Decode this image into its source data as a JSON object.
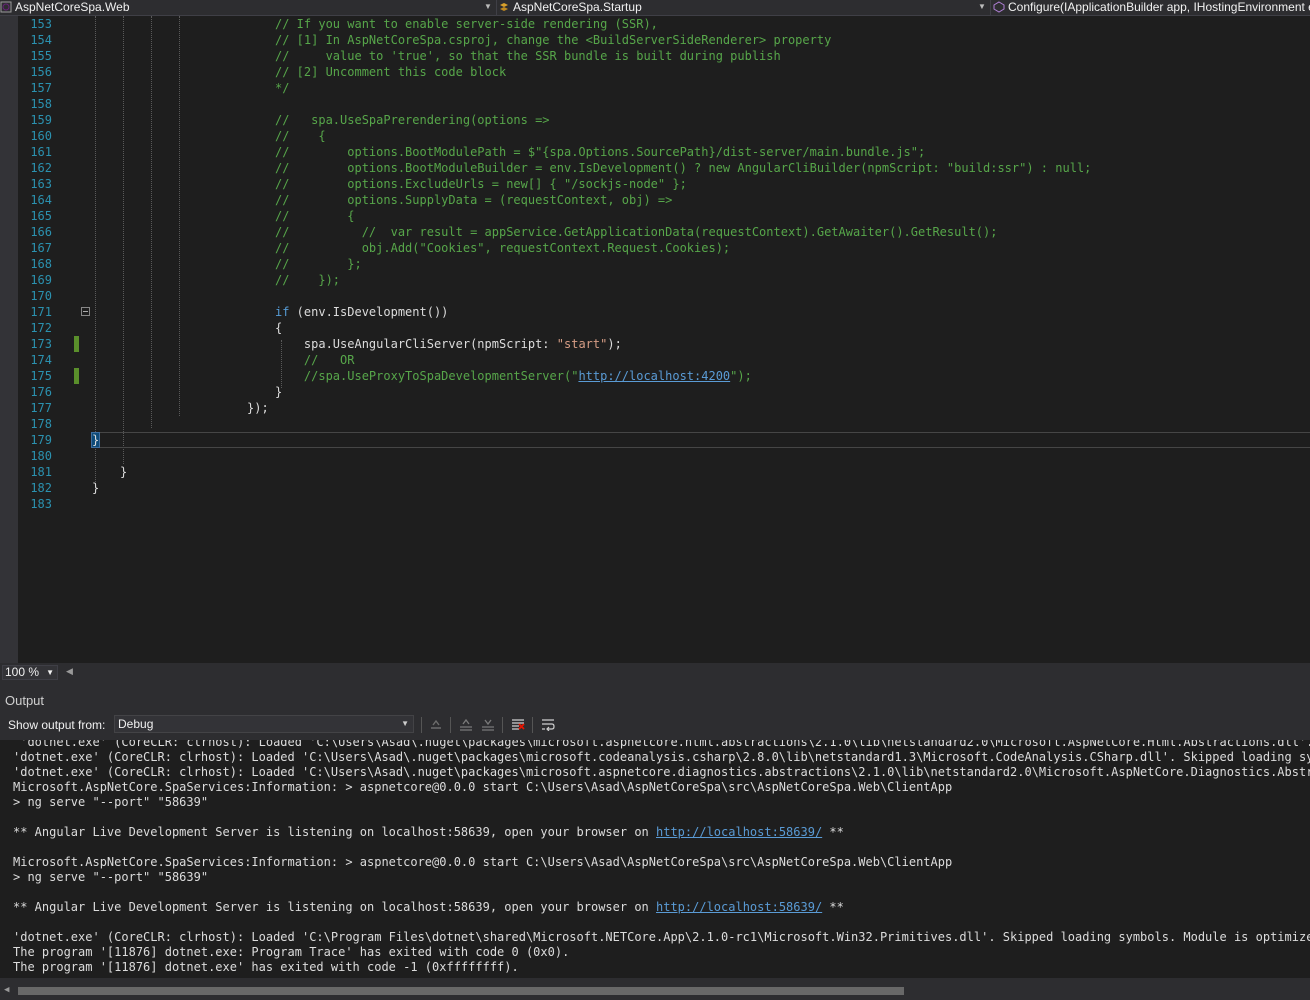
{
  "navbar": {
    "project": "AspNetCoreSpa.Web",
    "class": "AspNetCoreSpa.Startup",
    "member": "Configure(IApplicationBuilder app, IHostingEnvironment env)"
  },
  "editor": {
    "zoom": "100 %",
    "lines": [
      {
        "n": "153",
        "parts": [
          {
            "t": "cm",
            "v": "// If you want to enable server-side rendering (SSR),"
          }
        ]
      },
      {
        "n": "154",
        "parts": [
          {
            "t": "cm",
            "v": "// [1] In AspNetCoreSpa.csproj, change the <BuildServerSideRenderer> property"
          }
        ]
      },
      {
        "n": "155",
        "parts": [
          {
            "t": "cm",
            "v": "//     value to 'true', so that the SSR bundle is built during publish"
          }
        ]
      },
      {
        "n": "156",
        "parts": [
          {
            "t": "cm",
            "v": "// [2] Uncomment this code block"
          }
        ]
      },
      {
        "n": "157",
        "parts": [
          {
            "t": "cm",
            "v": "*/"
          }
        ]
      },
      {
        "n": "158",
        "parts": []
      },
      {
        "n": "159",
        "parts": [
          {
            "t": "cm",
            "v": "//   spa.UseSpaPrerendering(options =>"
          }
        ]
      },
      {
        "n": "160",
        "parts": [
          {
            "t": "cm",
            "v": "//    {"
          }
        ]
      },
      {
        "n": "161",
        "parts": [
          {
            "t": "cm",
            "v": "//        options.BootModulePath = $\"{spa.Options.SourcePath}/dist-server/main.bundle.js\";"
          }
        ]
      },
      {
        "n": "162",
        "parts": [
          {
            "t": "cm",
            "v": "//        options.BootModuleBuilder = env.IsDevelopment() ? new AngularCliBuilder(npmScript: \"build:ssr\") : null;"
          }
        ]
      },
      {
        "n": "163",
        "parts": [
          {
            "t": "cm",
            "v": "//        options.ExcludeUrls = new[] { \"/sockjs-node\" };"
          }
        ]
      },
      {
        "n": "164",
        "parts": [
          {
            "t": "cm",
            "v": "//        options.SupplyData = (requestContext, obj) =>"
          }
        ]
      },
      {
        "n": "165",
        "parts": [
          {
            "t": "cm",
            "v": "//        {"
          }
        ]
      },
      {
        "n": "166",
        "parts": [
          {
            "t": "cm",
            "v": "//          //  var result = appService.GetApplicationData(requestContext).GetAwaiter().GetResult();"
          }
        ]
      },
      {
        "n": "167",
        "parts": [
          {
            "t": "cm",
            "v": "//          obj.Add(\"Cookies\", requestContext.Request.Cookies);"
          }
        ]
      },
      {
        "n": "168",
        "parts": [
          {
            "t": "cm",
            "v": "//        };"
          }
        ]
      },
      {
        "n": "169",
        "parts": [
          {
            "t": "cm",
            "v": "//    });"
          }
        ]
      },
      {
        "n": "170",
        "parts": []
      },
      {
        "n": "171",
        "parts": [
          {
            "t": "kw",
            "v": "if"
          },
          {
            "t": "pl",
            "v": " (env.IsDevelopment())"
          }
        ]
      },
      {
        "n": "172",
        "parts": [
          {
            "t": "pl",
            "v": "{"
          }
        ]
      },
      {
        "n": "173",
        "parts": [
          {
            "t": "pl",
            "v": "    spa.UseAngularCliServer(npmScript: "
          },
          {
            "t": "str",
            "v": "\"start\""
          },
          {
            "t": "pl",
            "v": ");"
          }
        ]
      },
      {
        "n": "174",
        "parts": [
          {
            "t": "cm",
            "v": "    //   OR"
          }
        ]
      },
      {
        "n": "175",
        "parts": [
          {
            "t": "cm",
            "v": "    //spa.UseProxyToSpaDevelopmentServer(\""
          },
          {
            "t": "url",
            "v": "http://localhost:4200"
          },
          {
            "t": "cm",
            "v": "\");"
          }
        ]
      },
      {
        "n": "176",
        "parts": [
          {
            "t": "pl",
            "v": "}"
          }
        ]
      },
      {
        "n": "177",
        "parts": [
          {
            "t": "pl",
            "v": "});"
          }
        ]
      },
      {
        "n": "178",
        "parts": []
      },
      {
        "n": "179",
        "parts": [
          {
            "t": "br",
            "v": "}"
          }
        ]
      },
      {
        "n": "180",
        "parts": []
      },
      {
        "n": "181",
        "parts": [
          {
            "t": "pl",
            "v": "}"
          }
        ]
      },
      {
        "n": "182",
        "parts": [
          {
            "t": "pl",
            "v": "}"
          }
        ]
      },
      {
        "n": "183",
        "parts": []
      }
    ]
  },
  "output": {
    "title": "Output",
    "show_from_label": "Show output from:",
    "source": "Debug",
    "lines": [
      {
        "parts": [
          {
            "t": "pl",
            "v": " 'dotnet.exe' (CoreCLR: clrhost): Loaded 'C:\\Users\\Asad\\.nuget\\packages\\microsoft.aspnetcore.html.abstractions\\2.1.0\\lib\\netstandard2.0\\Microsoft.AspNetCore.Html.Abstractions.dll'. Skipped loading symbols."
          }
        ]
      },
      {
        "parts": [
          {
            "t": "pl",
            "v": "'dotnet.exe' (CoreCLR: clrhost): Loaded 'C:\\Users\\Asad\\.nuget\\packages\\microsoft.codeanalysis.csharp\\2.8.0\\lib\\netstandard1.3\\Microsoft.CodeAnalysis.CSharp.dll'. Skipped loading symbols. Module is optimized"
          }
        ]
      },
      {
        "parts": [
          {
            "t": "pl",
            "v": "'dotnet.exe' (CoreCLR: clrhost): Loaded 'C:\\Users\\Asad\\.nuget\\packages\\microsoft.aspnetcore.diagnostics.abstractions\\2.1.0\\lib\\netstandard2.0\\Microsoft.AspNetCore.Diagnostics.Abstractions.dll'."
          }
        ]
      },
      {
        "parts": [
          {
            "t": "pl",
            "v": "Microsoft.AspNetCore.SpaServices:Information: > aspnetcore@0.0.0 start C:\\Users\\Asad\\AspNetCoreSpa\\src\\AspNetCoreSpa.Web\\ClientApp"
          }
        ]
      },
      {
        "parts": [
          {
            "t": "pl",
            "v": "> ng serve \"--port\" \"58639\""
          }
        ]
      },
      {
        "parts": []
      },
      {
        "parts": [
          {
            "t": "pl",
            "v": "** Angular Live Development Server is listening on localhost:58639, open your browser on "
          },
          {
            "t": "url",
            "v": "http://localhost:58639/"
          },
          {
            "t": "pl",
            "v": " **"
          }
        ]
      },
      {
        "parts": []
      },
      {
        "parts": [
          {
            "t": "pl",
            "v": "Microsoft.AspNetCore.SpaServices:Information: > aspnetcore@0.0.0 start C:\\Users\\Asad\\AspNetCoreSpa\\src\\AspNetCoreSpa.Web\\ClientApp"
          }
        ]
      },
      {
        "parts": [
          {
            "t": "pl",
            "v": "> ng serve \"--port\" \"58639\""
          }
        ]
      },
      {
        "parts": []
      },
      {
        "parts": [
          {
            "t": "pl",
            "v": "** Angular Live Development Server is listening on localhost:58639, open your browser on "
          },
          {
            "t": "url",
            "v": "http://localhost:58639/"
          },
          {
            "t": "pl",
            "v": " **"
          }
        ]
      },
      {
        "parts": []
      },
      {
        "parts": [
          {
            "t": "pl",
            "v": "'dotnet.exe' (CoreCLR: clrhost): Loaded 'C:\\Program Files\\dotnet\\shared\\Microsoft.NETCore.App\\2.1.0-rc1\\Microsoft.Win32.Primitives.dll'. Skipped loading symbols. Module is optimized and the debugger"
          }
        ]
      },
      {
        "parts": [
          {
            "t": "pl",
            "v": "The program '[11876] dotnet.exe: Program Trace' has exited with code 0 (0x0)."
          }
        ]
      },
      {
        "parts": [
          {
            "t": "pl",
            "v": "The program '[11876] dotnet.exe' has exited with code -1 (0xffffffff)."
          }
        ]
      }
    ]
  },
  "icons": {
    "project": "csharp-project-icon",
    "class": "class-icon",
    "member": "method-icon",
    "toolbar": [
      "find-previous-icon",
      "go-to-previous-message-icon",
      "go-to-next-message-icon",
      "clear-all-icon",
      "toggle-word-wrap-icon"
    ]
  }
}
